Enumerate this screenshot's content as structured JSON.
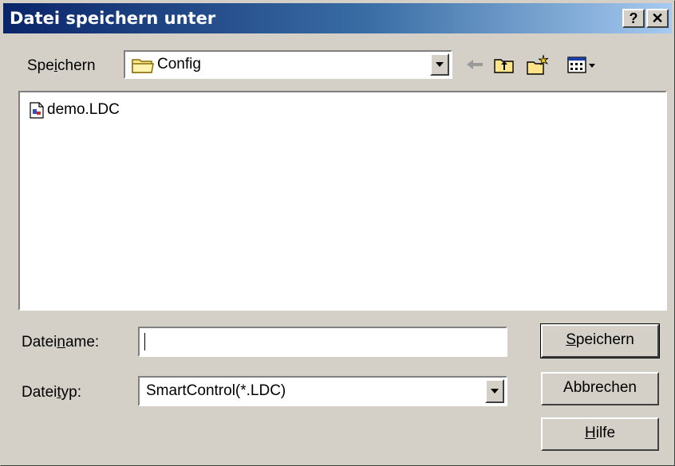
{
  "window": {
    "title": "Datei speichern unter",
    "help_button": "?",
    "close_button": "✕"
  },
  "save_in": {
    "label": "Speichern",
    "label_accesskey_index": 3,
    "folder": "Config",
    "folder_icon": "folder-icon"
  },
  "toolbar": {
    "icons": [
      "back-arrow-icon",
      "up-folder-icon",
      "new-folder-icon",
      "view-menu-icon"
    ]
  },
  "file_list": {
    "items": [
      {
        "name": "demo.LDC",
        "icon": "ldc-file-icon"
      }
    ]
  },
  "filename": {
    "label": "Dateiname:",
    "value": "",
    "placeholder": ""
  },
  "filetype": {
    "label": "Dateityp:",
    "selected": "SmartControl(*.LDC)"
  },
  "buttons": {
    "save": "Speichern",
    "cancel": "Abbrechen",
    "help": "Hilfe"
  }
}
